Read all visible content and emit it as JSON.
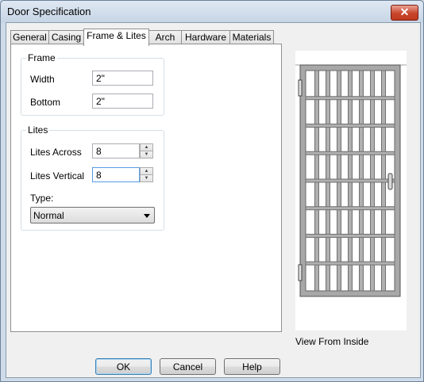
{
  "window": {
    "title": "Door Specification",
    "close_glyph": "✕"
  },
  "tabs": [
    {
      "label": "General"
    },
    {
      "label": "Casing"
    },
    {
      "label": "Frame & Lites"
    },
    {
      "label": "Arch"
    },
    {
      "label": "Hardware"
    },
    {
      "label": "Materials"
    }
  ],
  "active_tab": "Frame & Lites",
  "frame": {
    "legend": "Frame",
    "width_label": "Width",
    "width_value": "2\"",
    "bottom_label": "Bottom",
    "bottom_value": "2\""
  },
  "lites": {
    "legend": "Lites",
    "across_label": "Lites Across",
    "across_value": "8",
    "vertical_label": "Lites Vertical",
    "vertical_value": "8",
    "type_label": "Type:",
    "type_value": "Normal"
  },
  "preview": {
    "caption": "View From Inside",
    "lites_across": 8,
    "lites_vertical": 8,
    "frame_color": "#a0a0a0",
    "bar_color": "#707070"
  },
  "buttons": {
    "ok": "OK",
    "cancel": "Cancel",
    "help": "Help"
  }
}
